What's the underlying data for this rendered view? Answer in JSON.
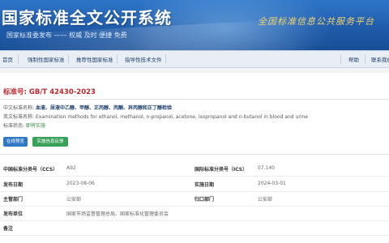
{
  "header": {
    "title": "国家标准全文公开系统",
    "subtitle": "国家标准委发布 —— 权威 及时 便捷 免费",
    "slogan": "全国标准信息公共服务平台",
    "bg_color": "#1e5aa8"
  },
  "nav": {
    "items": [
      {
        "label": "首页"
      },
      {
        "label": "强制性国家标准"
      },
      {
        "label": "推荐性国家标准"
      },
      {
        "label": "指导性技术文件"
      }
    ],
    "right": [
      {
        "label": "帮助"
      },
      {
        "label": "联系我们"
      }
    ]
  },
  "standard": {
    "number_label": "标准号:",
    "number": "GB/T 42430-2023",
    "cn_title_label": "中文标准名称:",
    "cn_title": "血液、尿液中乙醇、甲醇、正丙醇、丙酮、异丙醇和正丁醇检验",
    "en_title_label": "英文标准名称:",
    "en_title": "Examination methods for ethanol, methanol, n-propanol, acetone, isopropanol and n-butanol in blood and urine",
    "status_label": "标准状态:",
    "status": "即将实施"
  },
  "buttons": {
    "preview": "在线预览",
    "feedback": "实施信息反馈"
  },
  "details": {
    "ccs_label": "中国标准分类号（CCS）",
    "ccs": "A92",
    "ics_label": "国际标准分类号（ICS）",
    "ics": "07.140",
    "publish_date_label": "发布日期",
    "publish_date": "2023-08-06",
    "impl_date_label": "实施日期",
    "impl_date": "2024-03-01",
    "dept_label": "主管部门",
    "dept": "公安部",
    "central_dept_label": "归口部门",
    "central_dept": "公安部",
    "publisher_label": "发布单位",
    "publisher": "国家市场监督管理总局、国家标准化管理委员会",
    "remark_label": "备注"
  }
}
